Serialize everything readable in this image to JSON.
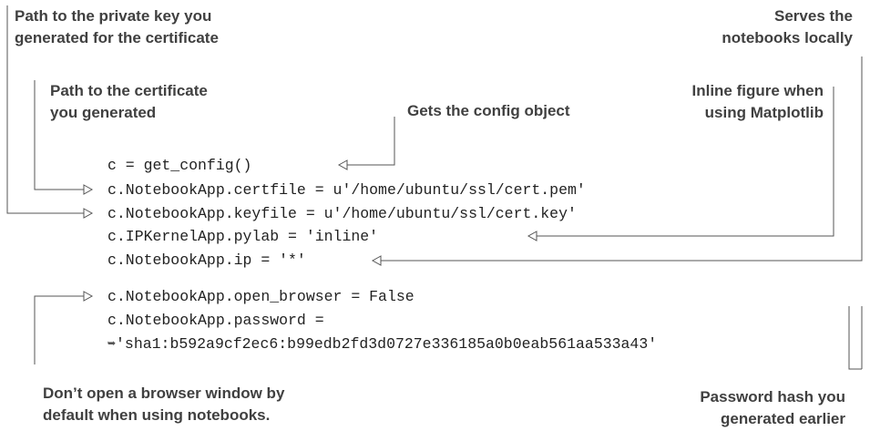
{
  "annotations": {
    "private_key": "Path to the private key you\ngenerated for the certificate",
    "certificate": "Path to the certificate\nyou generated",
    "config_object": "Gets the config object",
    "serves_locally": "Serves the\nnotebooks locally",
    "inline_figure": "Inline figure when\nusing Matplotlib",
    "no_browser": "Don’t open a browser window by\ndefault when using notebooks.",
    "password_hash": "Password hash you\ngenerated earlier"
  },
  "code": {
    "line1": "c = get_config()",
    "line2": "c.NotebookApp.certfile = u'/home/ubuntu/ssl/cert.pem'",
    "line3": "c.NotebookApp.keyfile = u'/home/ubuntu/ssl/cert.key'",
    "line4": "c.IPKernelApp.pylab = 'inline'",
    "line5": "c.NotebookApp.ip = '*'",
    "line6": "c.NotebookApp.open_browser = False",
    "line7": "c.NotebookApp.password =",
    "line8": "'sha1:b592a9cf2ec6:b99edb2fd3d0727e336185a0b0eab561aa533a43'"
  },
  "icons": {
    "continuation": "line-continuation-arrow-icon",
    "pointer": "hollow-triangle-arrow-icon"
  },
  "colors": {
    "text": "#404040",
    "code": "#222222",
    "lines": "#555555"
  }
}
